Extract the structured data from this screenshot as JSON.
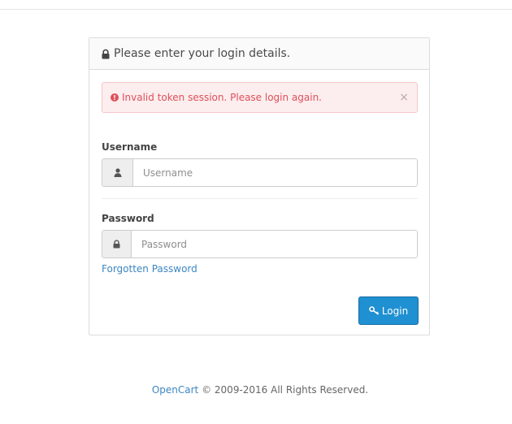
{
  "panel": {
    "heading": "Please enter your login details.",
    "heading_icon": "lock-icon"
  },
  "alert": {
    "message": "Invalid token session. Please login again.",
    "icon": "exclamation-circle-icon",
    "close_symbol": "×"
  },
  "form": {
    "username_label": "Username",
    "username_placeholder": "Username",
    "username_value": "",
    "password_label": "Password",
    "password_placeholder": "Password",
    "password_value": "",
    "forgot_link": "Forgotten Password",
    "login_button": "Login"
  },
  "footer": {
    "brand_link": "OpenCart",
    "copyright": "© 2009-2016 All Rights Reserved."
  },
  "colors": {
    "accent": "#1f90d1",
    "link": "#3c86c2",
    "alert_text": "#e0505a",
    "alert_bg": "#fcedee"
  }
}
